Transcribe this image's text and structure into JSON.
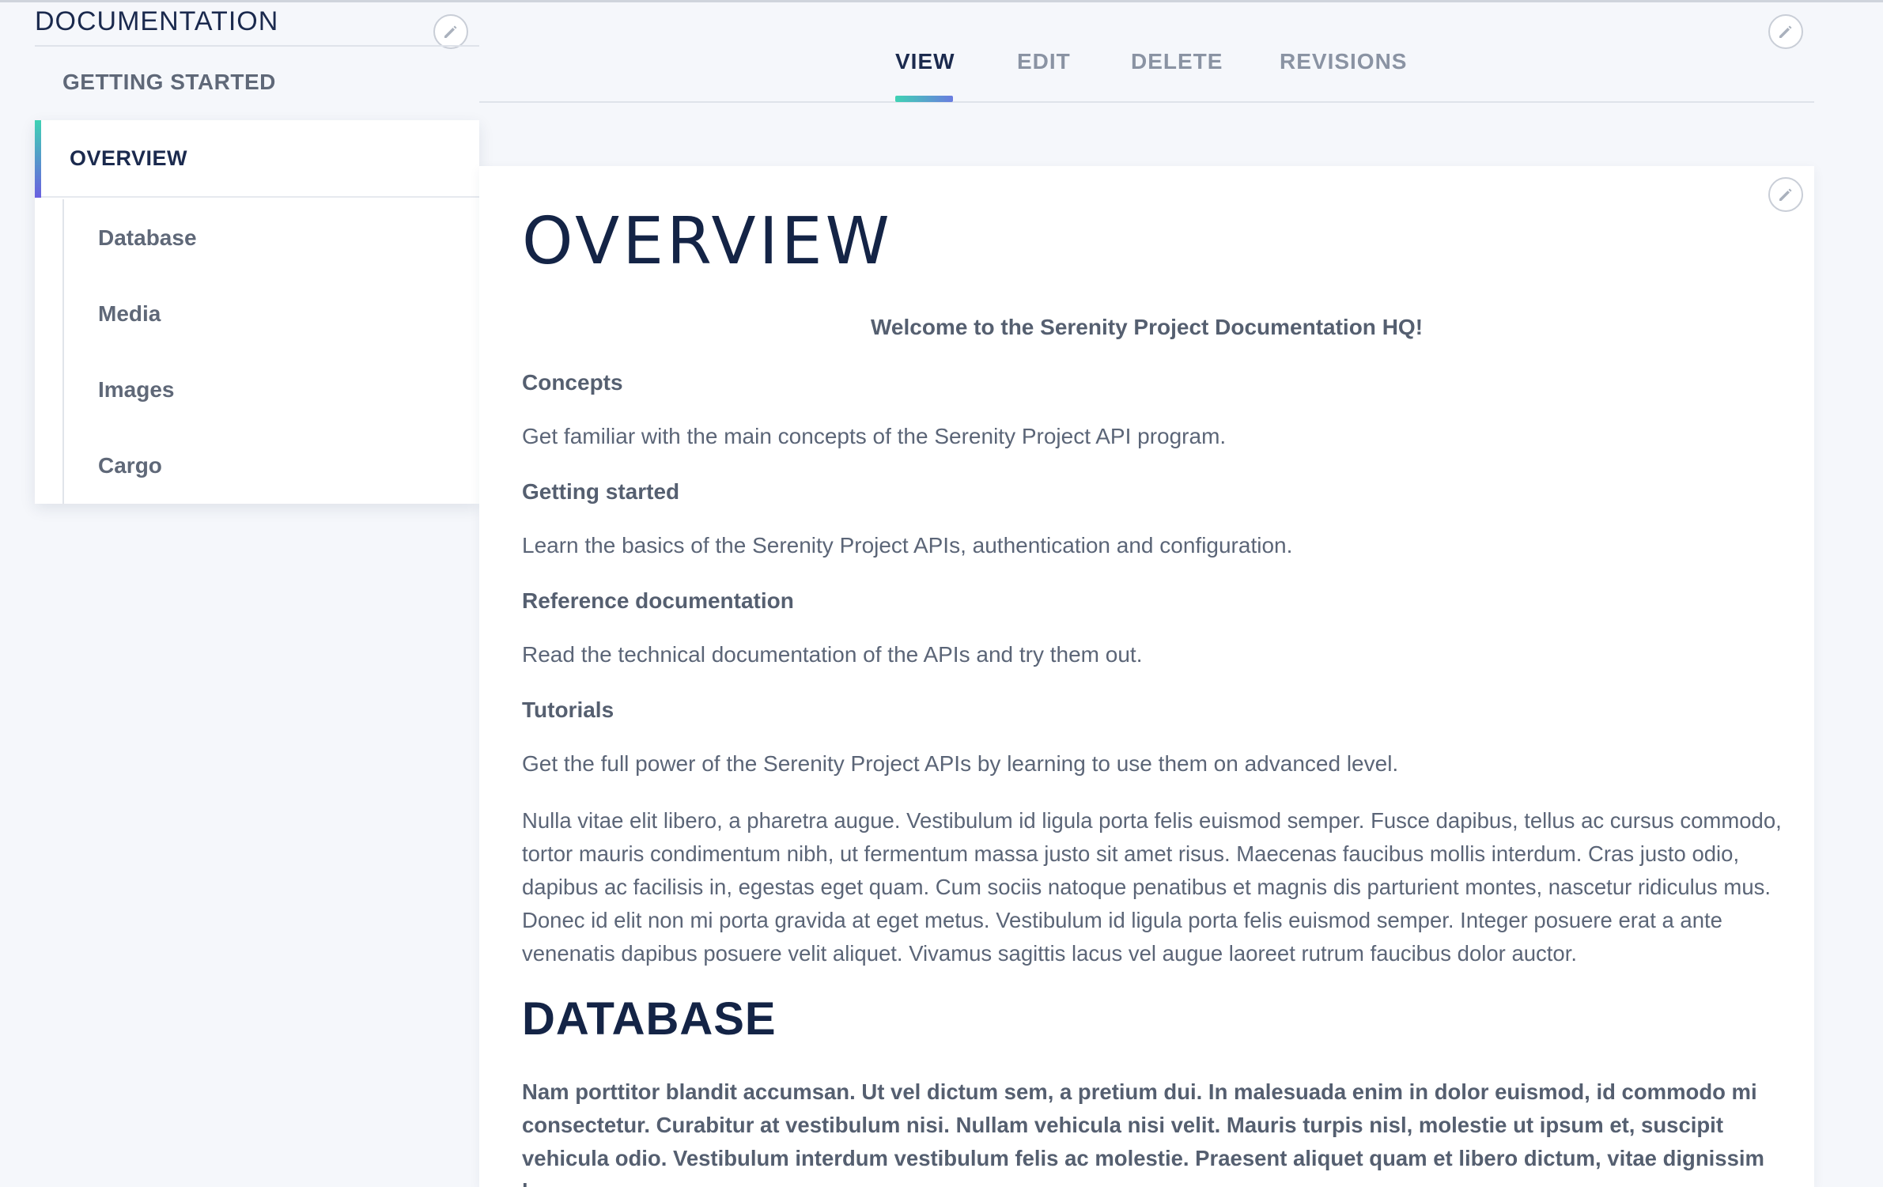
{
  "sidebar": {
    "title": "DOCUMENTATION",
    "getting_started": "GETTING STARTED",
    "active_item": "OVERVIEW",
    "sub_items": [
      "Database",
      "Media",
      "Images",
      "Cargo"
    ]
  },
  "tabs": [
    {
      "label": "VIEW",
      "active": true
    },
    {
      "label": "EDIT",
      "active": false
    },
    {
      "label": "DELETE",
      "active": false
    },
    {
      "label": "REVISIONS",
      "active": false
    }
  ],
  "content": {
    "title": "OVERVIEW",
    "welcome": "Welcome to the Serenity Project Documentation HQ!",
    "sections": [
      {
        "heading": "Concepts",
        "text": "Get familiar with the main concepts of the Serenity Project API program."
      },
      {
        "heading": "Getting started",
        "text": "Learn the basics of the Serenity Project APIs, authentication and configuration."
      },
      {
        "heading": "Reference documentation",
        "text": "Read the technical documentation of the APIs and try them out."
      },
      {
        "heading": "Tutorials",
        "text": "Get the full power of the Serenity Project APIs by learning to use them on advanced level."
      }
    ],
    "paragraph": "Nulla vitae elit libero, a pharetra augue. Vestibulum id ligula porta felis euismod semper. Fusce dapibus, tellus ac cursus commodo, tortor mauris condimentum nibh, ut fermentum massa justo sit amet risus. Maecenas faucibus mollis interdum. Cras justo odio, dapibus ac facilisis in, egestas eget quam. Cum sociis natoque penatibus et magnis dis parturient montes, nascetur ridiculus mus. Donec id elit non mi porta gravida at eget metus. Vestibulum id ligula porta felis euismod semper. Integer posuere erat a ante venenatis dapibus posuere velit aliquet. Vivamus sagittis lacus vel augue laoreet rutrum faucibus dolor auctor.",
    "database_title": "DATABASE",
    "database_paragraph": "Nam porttitor blandit accumsan. Ut vel dictum sem, a pretium dui. In malesuada enim in dolor euismod, id commodo mi consectetur. Curabitur at vestibulum nisi. Nullam vehicula nisi velit. Mauris turpis nisl, molestie ut ipsum et, suscipit vehicula odio. Vestibulum interdum vestibulum felis ac molestie. Praesent aliquet quam et libero dictum, vitae dignissim leo"
  },
  "icons": {
    "edit": "pencil-icon"
  },
  "colors": {
    "accent_start": "#3fd2b4",
    "accent_end": "#6a5fe0",
    "heading": "#142446",
    "text": "#5b6577"
  }
}
